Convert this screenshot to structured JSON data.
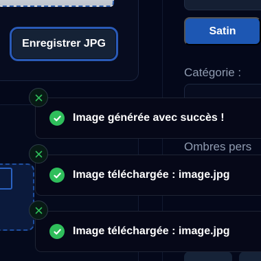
{
  "export": {
    "save_label": "Enregistrer JPG"
  },
  "style_options": {
    "active_label": "Satin"
  },
  "sidebar": {
    "category_label": "Catégorie :",
    "shadows_label": "Ombres pers"
  },
  "toasts": [
    {
      "message": "Image générée avec succès !",
      "status": "success",
      "icon": "check-circle-icon"
    },
    {
      "message": "Image téléchargée : image.jpg",
      "status": "success",
      "icon": "check-circle-icon"
    },
    {
      "message": "Image téléchargée : image.jpg",
      "status": "success",
      "icon": "check-circle-icon"
    }
  ],
  "colors": {
    "background": "#04081a",
    "accent": "#1d57b3",
    "success": "#2fbe5b",
    "toast_bg": "#060818"
  }
}
